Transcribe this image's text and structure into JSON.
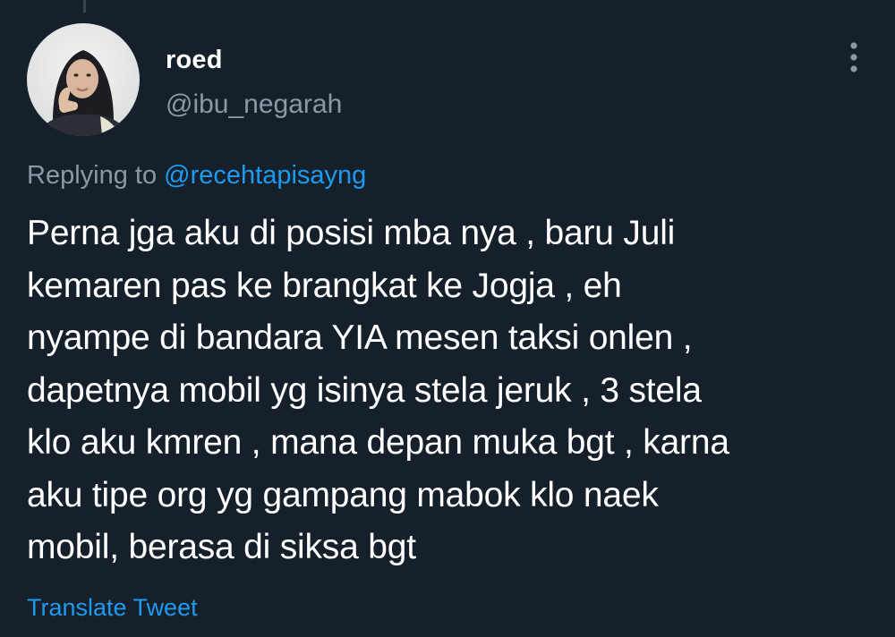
{
  "theme": {
    "background": "#15202b",
    "text_primary": "#ffffff",
    "text_secondary": "#8b98a5",
    "accent": "#1d9bf0"
  },
  "tweet": {
    "author": {
      "display_name": "roed",
      "handle": "@ibu_negarah",
      "avatar_icon": "profile-photo"
    },
    "more_icon": "vertical-ellipsis-icon",
    "replying_to_prefix": "Replying to",
    "replying_to_handle": "@recehtapisayng",
    "text": "Perna jga aku di posisi mba nya , baru Juli\nkemaren pas ke brangkat ke Jogja , eh\nnyampe di bandara YIA mesen taksi onlen ,\ndapetnya mobil yg isinya stela jeruk , 3 stela\nklo aku kmren , mana depan muka bgt , karna\naku tipe org yg gampang mabok klo naek\nmobil, berasa di siksa bgt",
    "translate_label": "Translate Tweet"
  }
}
